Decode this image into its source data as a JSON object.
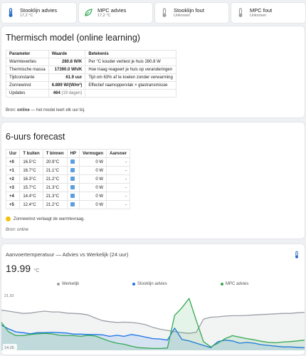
{
  "tiles": [
    {
      "name": "Stooklijn advies",
      "state": "17,2 °C",
      "icon": "thermometer-icon",
      "color": "#2a6cc4"
    },
    {
      "name": "MPC advies",
      "state": "17,2 °C",
      "icon": "leaf-icon",
      "color": "#34a853"
    },
    {
      "name": "Stooklijn fout",
      "state": "Unknown",
      "icon": "thermometer-icon",
      "color": "#9e9e9e"
    },
    {
      "name": "MPC fout",
      "state": "Unknown",
      "icon": "thermometer-icon",
      "color": "#9e9e9e"
    }
  ],
  "model": {
    "title": "Thermisch model (online learning)",
    "headers": [
      "Parameter",
      "Waarde",
      "Betekenis"
    ],
    "rows": [
      {
        "param": "Warmteverlies",
        "value": "280.8 W/K",
        "extra": "",
        "meaning": "Per °C kouder verliest je huis 280.8 W"
      },
      {
        "param": "Thermische massa",
        "value": "17390.0 Wh/K",
        "extra": "",
        "meaning": "Hoe traag reageert je huis op veranderingen"
      },
      {
        "param": "Tijdconstante",
        "value": "61.9 uur",
        "extra": "",
        "meaning": "Tijd om 63% af te koelen zonder verwarming"
      },
      {
        "param": "Zonnewinst",
        "value": "6.899 W/(W/m²)",
        "extra": "",
        "meaning": "Effectief raamoppervlak × glastransmissie"
      },
      {
        "param": "Updates",
        "value": "464",
        "extra": "(19 dagen)",
        "meaning": ""
      }
    ],
    "footer_prefix": "Bron: ",
    "footer_source": "online",
    "footer_suffix": " — het model leert elk uur bij."
  },
  "forecast": {
    "title": "6-uurs forecast",
    "headers": [
      "Uur",
      "T buiten",
      "T binnen",
      "HP",
      "Vermogen",
      "Aanvoer"
    ],
    "rows": [
      {
        "hour": "+0",
        "t_out": "16.5°C",
        "t_in": "20.9°C",
        "hp": "off",
        "power": "0 W",
        "supply": "-"
      },
      {
        "hour": "+1",
        "t_out": "16.7°C",
        "t_in": "21.1°C",
        "hp": "off",
        "power": "0 W",
        "supply": "-"
      },
      {
        "hour": "+2",
        "t_out": "16.3°C",
        "t_in": "21.2°C",
        "hp": "off",
        "power": "0 W",
        "supply": "-"
      },
      {
        "hour": "+3",
        "t_out": "15.7°C",
        "t_in": "21.3°C",
        "hp": "off",
        "power": "0 W",
        "supply": "-"
      },
      {
        "hour": "+4",
        "t_out": "14.4°C",
        "t_in": "21.3°C",
        "hp": "off",
        "power": "0 W",
        "supply": "-"
      },
      {
        "hour": "+5",
        "t_out": "12.4°C",
        "t_in": "21.2°C",
        "hp": "off",
        "power": "0 W",
        "supply": "-"
      }
    ],
    "note_icon": "sun-face-icon",
    "note": "Zonnewinst verlaagt de warmtevraag.",
    "source": "Bron: online"
  },
  "graph": {
    "title": "Aanvoertemperatuur — Advies vs Werkelijk (24 uur)",
    "current_value": "19.99",
    "current_unit": "°C",
    "icon": "thermometer-icon",
    "y_max_label": "21.92",
    "y_min_label": "14.35",
    "chart_data": {
      "type": "line",
      "ylim": [
        14.35,
        21.92
      ],
      "legend_position": "top",
      "series": [
        {
          "name": "Werkelijk",
          "color": "#9aa0a6",
          "values": [
            19.7,
            19.55,
            19.4,
            19.25,
            19.3,
            19.45,
            19.55,
            19.45,
            19.45,
            19.3,
            19.25,
            19.2,
            19.05,
            18.65,
            18.3,
            18.15,
            18.05,
            18.1,
            18.05,
            17.95,
            17.75,
            17.4,
            17.15,
            17.0,
            16.85,
            16.7,
            16.6,
            16.75,
            18.5,
            18.75,
            18.8,
            18.9,
            18.95,
            18.95,
            19.0,
            19.05,
            19.1,
            19.15,
            19.2,
            19.25,
            19.25,
            19.35,
            19.4
          ]
        },
        {
          "name": "Stooklijn advies",
          "color": "#1a73e8",
          "values": [
            17.7,
            17.2,
            16.8,
            16.7,
            16.55,
            16.7,
            16.7,
            16.75,
            16.7,
            16.65,
            16.5,
            16.5,
            16.45,
            16.45,
            16.4,
            16.2,
            16.35,
            16.2,
            16.45,
            16.3,
            16.1,
            15.9,
            15.85,
            15.7,
            17.3,
            15.8,
            15.6,
            15.3,
            15.0,
            14.7,
            15.5,
            15.7,
            15.6,
            15.3,
            15.4,
            15.3,
            15.1,
            15.0,
            14.9,
            14.8,
            14.8,
            14.75,
            14.7
          ]
        },
        {
          "name": "MPC advies",
          "color": "#34a853",
          "values": [
            18.05,
            16.8,
            16.3,
            16.3,
            16.45,
            16.55,
            16.6,
            16.55,
            16.35,
            16.3,
            16.3,
            16.2,
            16.35,
            16.25,
            15.9,
            15.55,
            15.3,
            15.15,
            14.9,
            14.7,
            14.65,
            14.6,
            14.6,
            14.65,
            19.0,
            20.0,
            21.25,
            18.3,
            15.5,
            14.8,
            15.3,
            15.9,
            16.3,
            16.1,
            15.9,
            15.75,
            15.55,
            15.4,
            15.35,
            15.45,
            15.5,
            15.6,
            15.7
          ]
        }
      ]
    }
  }
}
